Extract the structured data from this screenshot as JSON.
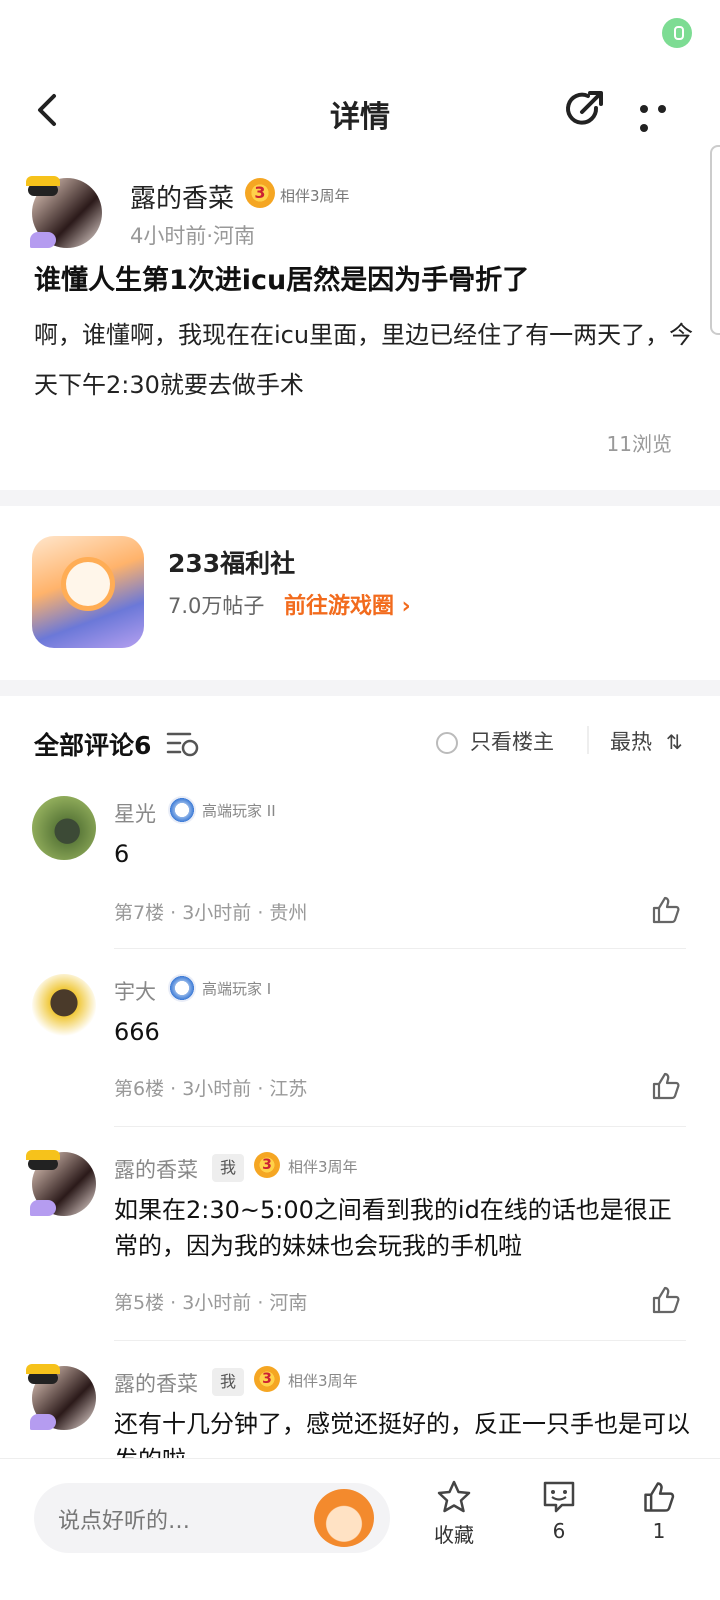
{
  "nav": {
    "title": "详情"
  },
  "post": {
    "author": "露的香菜",
    "badge_level": "3",
    "badge_text": "相伴3周年",
    "meta": "4小时前·河南",
    "title": "谁懂人生第1次进icu居然是因为手骨折了",
    "body": "啊，谁懂啊，我现在在icu里面，里边已经住了有一两天了，今天下午2:30就要去做手术",
    "views": "11浏览"
  },
  "circle": {
    "name": "233福利社",
    "posts": "7.0万帖子",
    "go_label": "前往游戏圈 ›"
  },
  "comments_header": {
    "title": "全部评论6",
    "owner_only": "只看楼主",
    "sort": "最热",
    "sort_icon": "⇅"
  },
  "comments": [
    {
      "name": "星光",
      "level_text": "高端玩家 II",
      "text": "6",
      "meta": "第7楼 · 3小时前 · 贵州"
    },
    {
      "name": "宇大",
      "level_text": "高端玩家 I",
      "text": "666",
      "meta": "第6楼 · 3小时前 · 江苏"
    },
    {
      "name": "露的香菜",
      "me_tag": "我",
      "badge_level": "3",
      "level_text": "相伴3周年",
      "text": "如果在2:30~5:00之间看到我的id在线的话也是很正常的，因为我的妹妹也会玩我的手机啦",
      "meta": "第5楼 · 3小时前 · 河南"
    },
    {
      "name": "露的香菜",
      "me_tag": "我",
      "badge_level": "3",
      "level_text": "相伴3周年",
      "text": "还有十几分钟了，感觉还挺好的，反正一只手也是可以发的啦"
    }
  ],
  "bottom": {
    "placeholder": "说点好听的…",
    "favorite_label": "收藏",
    "comment_count": "6",
    "like_count": "1"
  },
  "colors": {
    "accent": "#f26b1d",
    "mic": "#7ddc93"
  }
}
